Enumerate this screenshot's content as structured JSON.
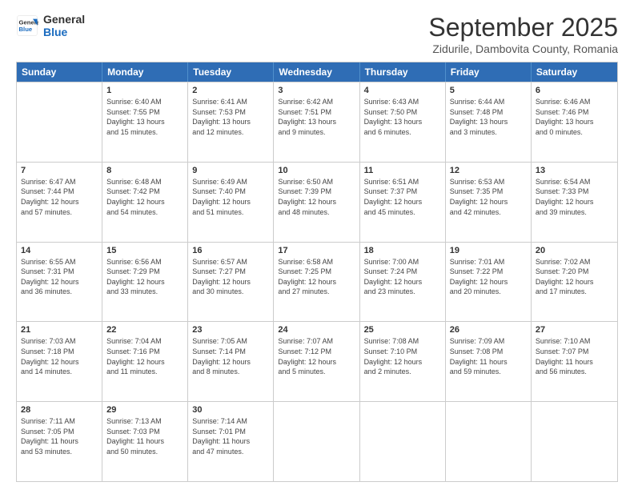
{
  "header": {
    "logo_line1": "General",
    "logo_line2": "Blue",
    "month": "September 2025",
    "location": "Zidurile, Dambovita County, Romania"
  },
  "weekdays": [
    "Sunday",
    "Monday",
    "Tuesday",
    "Wednesday",
    "Thursday",
    "Friday",
    "Saturday"
  ],
  "rows": [
    [
      {
        "day": "",
        "info": ""
      },
      {
        "day": "1",
        "info": "Sunrise: 6:40 AM\nSunset: 7:55 PM\nDaylight: 13 hours\nand 15 minutes."
      },
      {
        "day": "2",
        "info": "Sunrise: 6:41 AM\nSunset: 7:53 PM\nDaylight: 13 hours\nand 12 minutes."
      },
      {
        "day": "3",
        "info": "Sunrise: 6:42 AM\nSunset: 7:51 PM\nDaylight: 13 hours\nand 9 minutes."
      },
      {
        "day": "4",
        "info": "Sunrise: 6:43 AM\nSunset: 7:50 PM\nDaylight: 13 hours\nand 6 minutes."
      },
      {
        "day": "5",
        "info": "Sunrise: 6:44 AM\nSunset: 7:48 PM\nDaylight: 13 hours\nand 3 minutes."
      },
      {
        "day": "6",
        "info": "Sunrise: 6:46 AM\nSunset: 7:46 PM\nDaylight: 13 hours\nand 0 minutes."
      }
    ],
    [
      {
        "day": "7",
        "info": "Sunrise: 6:47 AM\nSunset: 7:44 PM\nDaylight: 12 hours\nand 57 minutes."
      },
      {
        "day": "8",
        "info": "Sunrise: 6:48 AM\nSunset: 7:42 PM\nDaylight: 12 hours\nand 54 minutes."
      },
      {
        "day": "9",
        "info": "Sunrise: 6:49 AM\nSunset: 7:40 PM\nDaylight: 12 hours\nand 51 minutes."
      },
      {
        "day": "10",
        "info": "Sunrise: 6:50 AM\nSunset: 7:39 PM\nDaylight: 12 hours\nand 48 minutes."
      },
      {
        "day": "11",
        "info": "Sunrise: 6:51 AM\nSunset: 7:37 PM\nDaylight: 12 hours\nand 45 minutes."
      },
      {
        "day": "12",
        "info": "Sunrise: 6:53 AM\nSunset: 7:35 PM\nDaylight: 12 hours\nand 42 minutes."
      },
      {
        "day": "13",
        "info": "Sunrise: 6:54 AM\nSunset: 7:33 PM\nDaylight: 12 hours\nand 39 minutes."
      }
    ],
    [
      {
        "day": "14",
        "info": "Sunrise: 6:55 AM\nSunset: 7:31 PM\nDaylight: 12 hours\nand 36 minutes."
      },
      {
        "day": "15",
        "info": "Sunrise: 6:56 AM\nSunset: 7:29 PM\nDaylight: 12 hours\nand 33 minutes."
      },
      {
        "day": "16",
        "info": "Sunrise: 6:57 AM\nSunset: 7:27 PM\nDaylight: 12 hours\nand 30 minutes."
      },
      {
        "day": "17",
        "info": "Sunrise: 6:58 AM\nSunset: 7:25 PM\nDaylight: 12 hours\nand 27 minutes."
      },
      {
        "day": "18",
        "info": "Sunrise: 7:00 AM\nSunset: 7:24 PM\nDaylight: 12 hours\nand 23 minutes."
      },
      {
        "day": "19",
        "info": "Sunrise: 7:01 AM\nSunset: 7:22 PM\nDaylight: 12 hours\nand 20 minutes."
      },
      {
        "day": "20",
        "info": "Sunrise: 7:02 AM\nSunset: 7:20 PM\nDaylight: 12 hours\nand 17 minutes."
      }
    ],
    [
      {
        "day": "21",
        "info": "Sunrise: 7:03 AM\nSunset: 7:18 PM\nDaylight: 12 hours\nand 14 minutes."
      },
      {
        "day": "22",
        "info": "Sunrise: 7:04 AM\nSunset: 7:16 PM\nDaylight: 12 hours\nand 11 minutes."
      },
      {
        "day": "23",
        "info": "Sunrise: 7:05 AM\nSunset: 7:14 PM\nDaylight: 12 hours\nand 8 minutes."
      },
      {
        "day": "24",
        "info": "Sunrise: 7:07 AM\nSunset: 7:12 PM\nDaylight: 12 hours\nand 5 minutes."
      },
      {
        "day": "25",
        "info": "Sunrise: 7:08 AM\nSunset: 7:10 PM\nDaylight: 12 hours\nand 2 minutes."
      },
      {
        "day": "26",
        "info": "Sunrise: 7:09 AM\nSunset: 7:08 PM\nDaylight: 11 hours\nand 59 minutes."
      },
      {
        "day": "27",
        "info": "Sunrise: 7:10 AM\nSunset: 7:07 PM\nDaylight: 11 hours\nand 56 minutes."
      }
    ],
    [
      {
        "day": "28",
        "info": "Sunrise: 7:11 AM\nSunset: 7:05 PM\nDaylight: 11 hours\nand 53 minutes."
      },
      {
        "day": "29",
        "info": "Sunrise: 7:13 AM\nSunset: 7:03 PM\nDaylight: 11 hours\nand 50 minutes."
      },
      {
        "day": "30",
        "info": "Sunrise: 7:14 AM\nSunset: 7:01 PM\nDaylight: 11 hours\nand 47 minutes."
      },
      {
        "day": "",
        "info": ""
      },
      {
        "day": "",
        "info": ""
      },
      {
        "day": "",
        "info": ""
      },
      {
        "day": "",
        "info": ""
      }
    ]
  ]
}
